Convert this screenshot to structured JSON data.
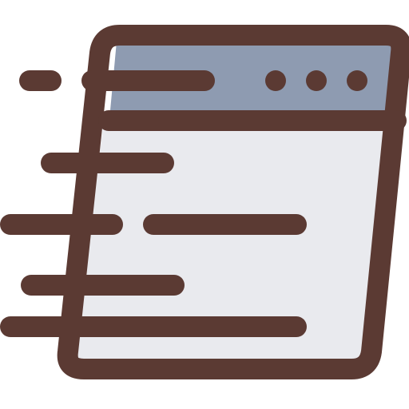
{
  "icon": {
    "name": "fast-browser-window-icon",
    "colors": {
      "outline": "#5b3a33",
      "title_bar": "#8e9bb1",
      "page_body": "#e9eaee"
    }
  },
  "window": {
    "controls": {
      "count": 3
    }
  }
}
